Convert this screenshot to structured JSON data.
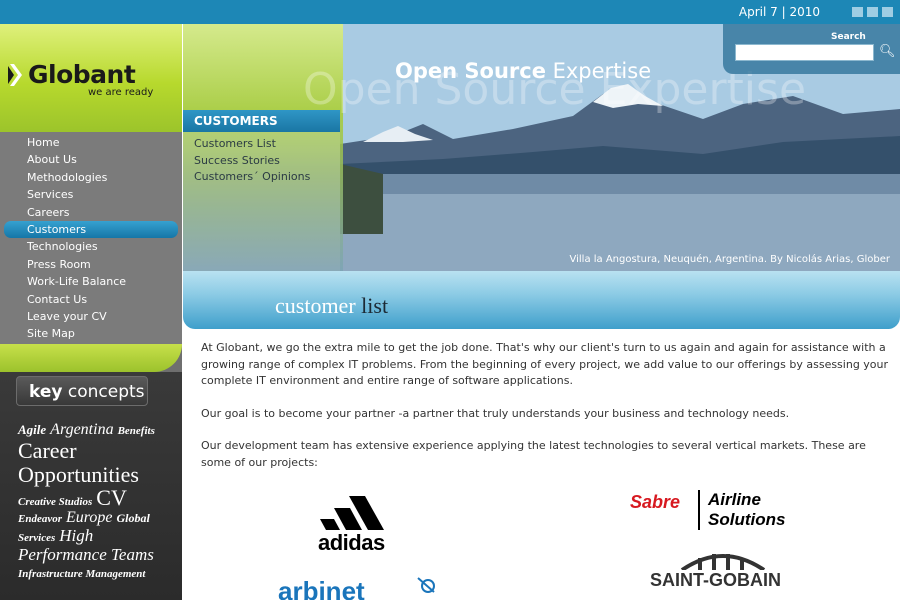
{
  "topbar": {
    "date": "April 7 | 2010"
  },
  "logo": {
    "name": "Globant",
    "tagline": "we are ready"
  },
  "nav": {
    "items": [
      {
        "label": "Home"
      },
      {
        "label": "About Us"
      },
      {
        "label": "Methodologies"
      },
      {
        "label": "Services"
      },
      {
        "label": "Careers"
      },
      {
        "label": "Customers"
      },
      {
        "label": "Technologies"
      },
      {
        "label": "Press Room"
      },
      {
        "label": "Work-Life Balance"
      },
      {
        "label": "Contact Us"
      },
      {
        "label": "Leave your CV"
      },
      {
        "label": "Site Map"
      }
    ],
    "active_index": 5
  },
  "key_concepts": {
    "title_bold": "key",
    "title_rest": " concepts",
    "tags": [
      "Agile",
      "Argentina",
      "Benefits",
      "Career",
      "Opportunities",
      "Creative Studios",
      "CV",
      "Endeavor",
      "Europe",
      "Global",
      "Services",
      "High",
      "Performance Teams",
      "Infrastructure Management"
    ]
  },
  "hero": {
    "title_bold": "Open Source",
    "title_rest": " Expertise",
    "caption": "Villa la Angostura, Neuquén, Argentina. By Nicolás Arias, Glober"
  },
  "search": {
    "label": "Search",
    "placeholder": ""
  },
  "customers_menu": {
    "heading": "CUSTOMERS",
    "links": [
      "Customers List",
      "Success Stories",
      "Customers´ Opinions"
    ]
  },
  "section": {
    "title_light": "customer",
    "title_dark": " list"
  },
  "content": {
    "p1": "At Globant, we go the extra mile to get the job done. That's why our client's turn to us again and again for assistance with a growing range of complex IT problems. From the beginning of every project, we add value to our offerings by assessing your complete IT environment and entire range of software applications.",
    "p2": "Our goal is to become your partner -a partner that truly understands your business and technology needs.",
    "p3": "Our development team has extensive experience applying the latest technologies to several vertical markets. These are some of our projects:"
  },
  "clients": {
    "adidas": "adidas",
    "sabre": "Sabre",
    "sabre_line1": "Airline",
    "sabre_line2": "Solutions",
    "saint_gobain": "SAINT-GOBAIN",
    "arbinet": "arbinet"
  },
  "colors": {
    "topbar": "#1d87b6",
    "brand_green": "#b7d92d",
    "nav_bg": "#7b7b7b",
    "active_blue": "#1576a7",
    "sabre_red": "#d71920"
  }
}
